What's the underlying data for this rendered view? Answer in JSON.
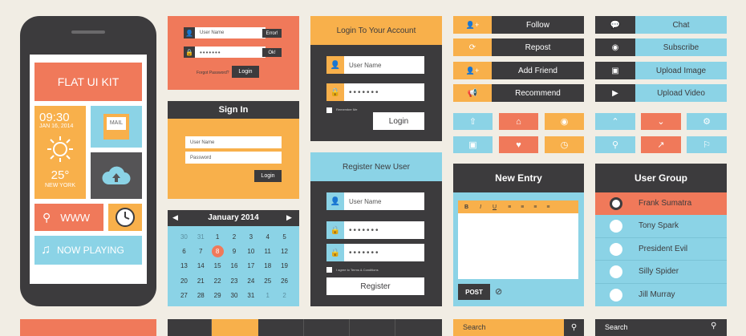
{
  "phone": {
    "kit_title": "FLAT UI KIT",
    "time": "09:30",
    "date": "JAN 16, 2014",
    "temperature": "25°",
    "city": "NEW YORK",
    "mail_label": "MAIL",
    "web_label": "WWW",
    "now_playing": "NOW PLAYING"
  },
  "small_login": {
    "username_placeholder": "User Name",
    "error_label": "Error!",
    "password_dots": "•••••••",
    "ok_label": "Ok!",
    "forgot_label": "Forgot Password?",
    "login_button": "Login"
  },
  "signin": {
    "title": "Sign In",
    "username_placeholder": "User Name",
    "password_placeholder": "Password",
    "login_button": "Login"
  },
  "calendar": {
    "month": "January 2014",
    "days": [
      "30",
      "31",
      "1",
      "2",
      "3",
      "4",
      "5",
      "6",
      "7",
      "8",
      "9",
      "10",
      "11",
      "12",
      "13",
      "14",
      "15",
      "16",
      "17",
      "18",
      "19",
      "20",
      "21",
      "22",
      "23",
      "24",
      "25",
      "26",
      "27",
      "28",
      "29",
      "30",
      "31",
      "1",
      "2"
    ]
  },
  "login_panel": {
    "title": "Login To Your Account",
    "username_placeholder": "User Name",
    "password_dots": "•••••••",
    "remember_label": "Remember Me",
    "login_button": "Login"
  },
  "register_panel": {
    "title": "Register New User",
    "username_placeholder": "User Name",
    "password_dots": "•••••••",
    "password2_dots": "•••••••",
    "terms_label": "I agree to Terms & Conditions",
    "register_button": "Register"
  },
  "action_buttons": {
    "follow": "Follow",
    "repost": "Repost",
    "add_friend": "Add Friend",
    "recommend": "Recommend",
    "chat": "Chat",
    "subscribe": "Subscribe",
    "upload_image": "Upload Image",
    "upload_video": "Upload Video"
  },
  "new_entry": {
    "title": "New Entry",
    "toolbar": [
      "B",
      "I",
      "U"
    ],
    "post_button": "POST"
  },
  "user_group": {
    "title": "User Group",
    "users": [
      "Frank Sumatra",
      "Tony Spark",
      "President Evil",
      "Silly Spider",
      "Jill Murray"
    ]
  },
  "search": {
    "placeholder1": "Search",
    "placeholder2": "Search"
  },
  "colors": {
    "dark": "#3c3b3d",
    "orange": "#f0795a",
    "yellow": "#f8b04b",
    "blue": "#8bd3e6",
    "background": "#f1ede4"
  }
}
